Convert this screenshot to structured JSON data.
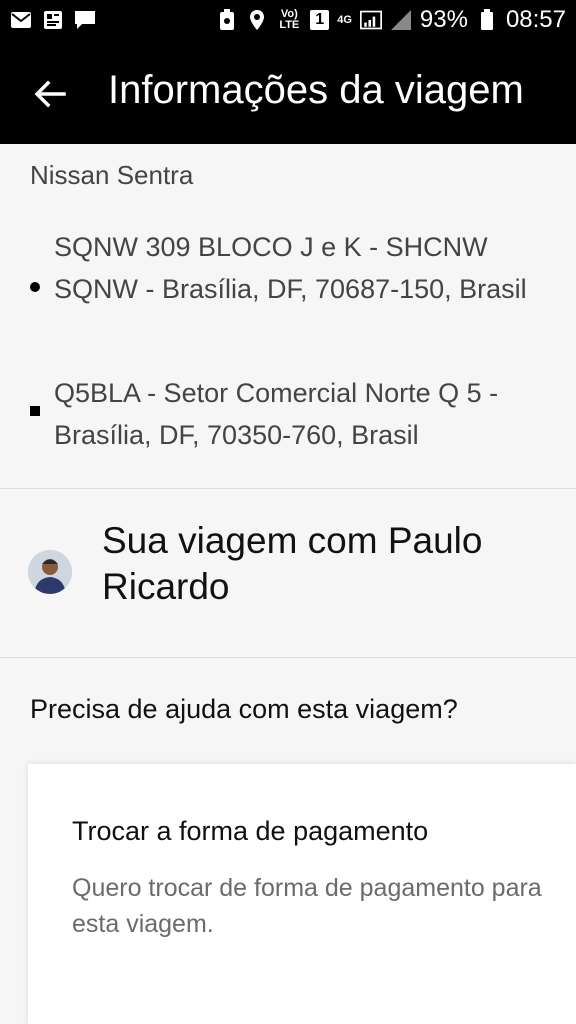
{
  "status_bar": {
    "icons_left": [
      "mail-icon",
      "gallery-icon",
      "message-icon"
    ],
    "volte": "Vo) LTE",
    "sim": "1",
    "network": "4G",
    "battery": "93%",
    "time": "08:57"
  },
  "header": {
    "title": "Informações da viagem",
    "back_icon": "arrow-left-icon"
  },
  "trip": {
    "vehicle": "Nissan Sentra",
    "stops": [
      "SQNW 309 BLOCO J e K - SHCNW SQNW - Brasília, DF, 70687-150, Brasil",
      "Q5BLA - Setor Comercial Norte Q 5 - Brasília, DF, 70350-760, Brasil"
    ]
  },
  "driver": {
    "title": "Sua viagem com Paulo Ricardo"
  },
  "help": {
    "heading": "Precisa de ajuda com esta viagem?",
    "options": [
      {
        "title": "Trocar a forma de pagamento",
        "description": "Quero trocar de forma de pagamento para esta viagem."
      }
    ]
  },
  "colors": {
    "header_bg": "#000000",
    "page_bg": "#f6f6f6",
    "card_bg": "#ffffff",
    "secondary_text": "#6b6b6b"
  }
}
